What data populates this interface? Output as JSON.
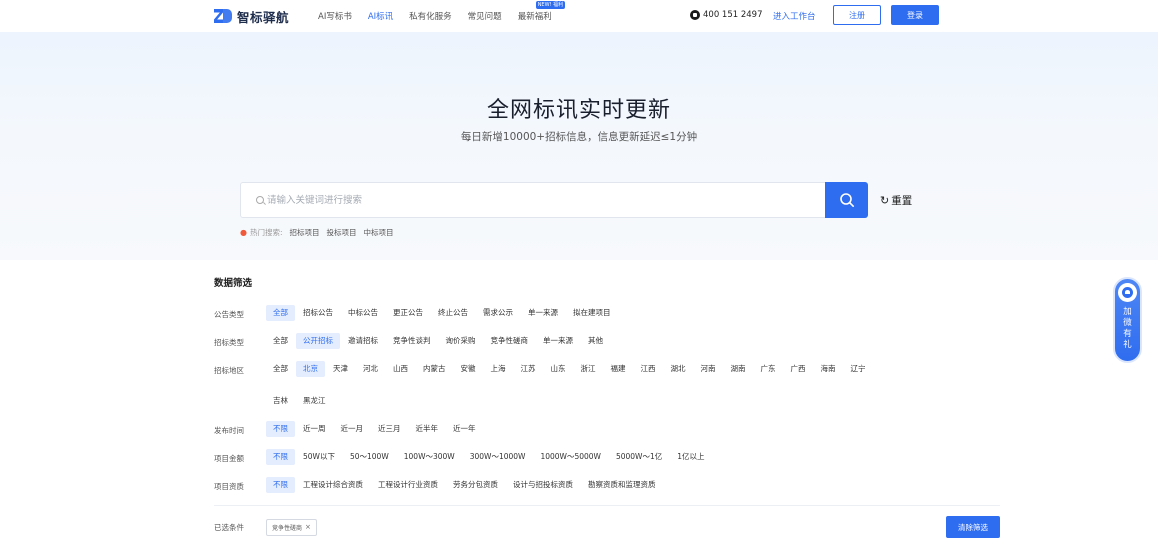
{
  "header": {
    "logo_text": "智标驿航",
    "nav": [
      {
        "label": "AI写标书",
        "active": false
      },
      {
        "label": "AI标讯",
        "active": true
      },
      {
        "label": "私有化服务",
        "active": false
      },
      {
        "label": "常见问题",
        "active": false
      },
      {
        "label": "最新福利",
        "active": false,
        "badge": "NEW! 福利"
      }
    ],
    "phone": "400 151 2497",
    "workbench": "进入工作台",
    "register": "注册",
    "login": "登录"
  },
  "hero": {
    "title": "全网标讯实时更新",
    "subtitle": "每日新增10000+招标信息，信息更新延迟≤1分钟",
    "search_placeholder": "请输入关键词进行搜索",
    "reset": "重置",
    "hot_label": "热门搜索:",
    "hot_items": [
      "招标项目",
      "投标项目",
      "中标项目"
    ]
  },
  "filters": {
    "title": "数据筛选",
    "rows": [
      {
        "label": "公告类型",
        "options": [
          "全部",
          "招标公告",
          "中标公告",
          "更正公告",
          "终止公告",
          "需求公示",
          "单一来源",
          "拟在建项目"
        ],
        "selected": 0
      },
      {
        "label": "招标类型",
        "options": [
          "全部",
          "公开招标",
          "邀请招标",
          "竞争性谈判",
          "询价采购",
          "竞争性磋商",
          "单一来源",
          "其他"
        ],
        "selected": 1
      },
      {
        "label": "招标地区",
        "options": [
          "全部",
          "北京",
          "天津",
          "河北",
          "山西",
          "内蒙古",
          "安徽",
          "上海",
          "江苏",
          "山东",
          "浙江",
          "福建",
          "江西",
          "湖北",
          "河南",
          "湖南",
          "广东",
          "广西",
          "海南",
          "辽宁",
          "吉林",
          "黑龙江"
        ],
        "selected": 1
      },
      {
        "label": "发布时间",
        "options": [
          "不限",
          "近一周",
          "近一月",
          "近三月",
          "近半年",
          "近一年"
        ],
        "selected": 0
      },
      {
        "label": "项目金额",
        "options": [
          "不限",
          "50W以下",
          "50～100W",
          "100W～300W",
          "300W～1000W",
          "1000W～5000W",
          "5000W～1亿",
          "1亿以上"
        ],
        "selected": 0
      },
      {
        "label": "项目资质",
        "options": [
          "不限",
          "工程设计综合资质",
          "工程设计行业资质",
          "劳务分包资质",
          "设计与招投标资质",
          "勘察资质和监理资质"
        ],
        "selected": 0
      }
    ],
    "selected_label": "已选条件",
    "selected_chips": [
      "竞争性磋商"
    ],
    "clear_button": "清除筛选"
  },
  "float_gift": {
    "text": "加微有礼"
  },
  "colors": {
    "primary": "#2f6df0",
    "selected_bg": "#e4edfd"
  }
}
